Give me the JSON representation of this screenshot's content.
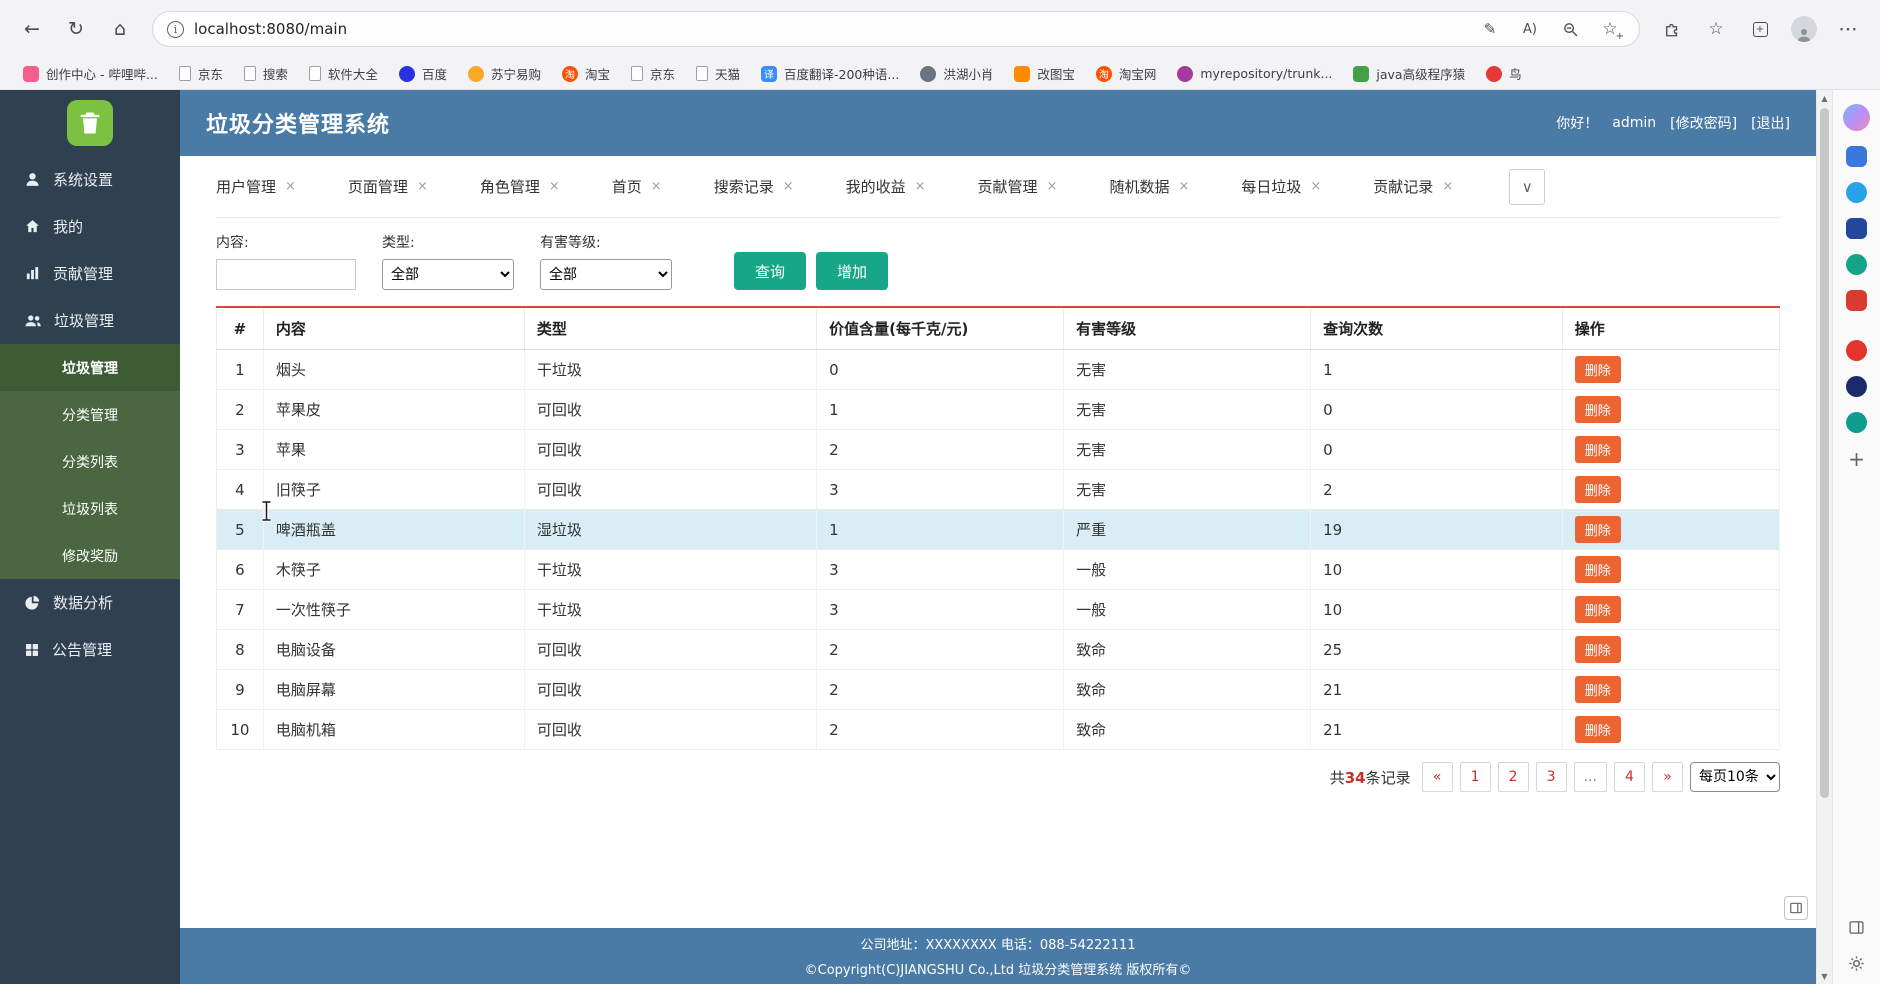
{
  "icons": {
    "back": "←",
    "refresh": "↻",
    "home": "⌂",
    "info": "i",
    "pen": "✎",
    "read_aloud": "A)",
    "star": "☆",
    "plus": "+",
    "ellipsis": "⋯",
    "chevron_down": "∨",
    "close": "×",
    "scroll_up": "▲",
    "scroll_down": "▼",
    "taobao_glyph": "淘",
    "fanyi_glyph": "译"
  },
  "browser": {
    "url": "localhost:8080/main",
    "bookmarks": [
      {
        "label": "创作中心 - 哔哩哔..."
      },
      {
        "label": "京东"
      },
      {
        "label": "搜索"
      },
      {
        "label": "软件大全"
      },
      {
        "label": "百度"
      },
      {
        "label": "苏宁易购"
      },
      {
        "label": "淘宝"
      },
      {
        "label": "京东"
      },
      {
        "label": "天猫"
      },
      {
        "label": "百度翻译-200种语..."
      },
      {
        "label": "洪湖小肖"
      },
      {
        "label": "改图宝"
      },
      {
        "label": "淘宝网"
      },
      {
        "label": "myrepository/trunk..."
      },
      {
        "label": "java高级程序猿"
      },
      {
        "label": "鸟"
      }
    ]
  },
  "app": {
    "title": "垃圾分类管理系统",
    "user": {
      "greeting": "你好！",
      "name": "admin",
      "change_password": "[修改密码]",
      "logout": "[退出]"
    },
    "sidebar": {
      "items": [
        {
          "label": "系统设置"
        },
        {
          "label": "我的"
        },
        {
          "label": "贡献管理"
        },
        {
          "label": "垃圾管理"
        },
        {
          "label": "数据分析"
        },
        {
          "label": "公告管理"
        }
      ],
      "submenu": [
        {
          "label": "垃圾管理"
        },
        {
          "label": "分类管理"
        },
        {
          "label": "分类列表"
        },
        {
          "label": "垃圾列表"
        },
        {
          "label": "修改奖励"
        }
      ]
    },
    "tabs": [
      {
        "label": "用户管理"
      },
      {
        "label": "页面管理"
      },
      {
        "label": "角色管理"
      },
      {
        "label": "首页"
      },
      {
        "label": "搜索记录"
      },
      {
        "label": "我的收益"
      },
      {
        "label": "贡献管理"
      },
      {
        "label": "随机数据"
      },
      {
        "label": "每日垃圾"
      },
      {
        "label": "贡献记录"
      }
    ],
    "filters": {
      "content_label": "内容:",
      "type_label": "类型:",
      "type_value": "全部",
      "level_label": "有害等级:",
      "level_value": "全部",
      "search_label": "查询",
      "add_label": "增加"
    },
    "table": {
      "headers": [
        "#",
        "内容",
        "类型",
        "价值含量(每千克/元)",
        "有害等级",
        "查询次数",
        "操作"
      ],
      "delete_label": "删除",
      "rows": [
        {
          "num": "1",
          "content": "烟头",
          "type": "干垃圾",
          "value": "0",
          "level": "无害",
          "count": "1"
        },
        {
          "num": "2",
          "content": "苹果皮",
          "type": "可回收",
          "value": "1",
          "level": "无害",
          "count": "0"
        },
        {
          "num": "3",
          "content": "苹果",
          "type": "可回收",
          "value": "2",
          "level": "无害",
          "count": "0"
        },
        {
          "num": "4",
          "content": "旧筷子",
          "type": "可回收",
          "value": "3",
          "level": "无害",
          "count": "2"
        },
        {
          "num": "5",
          "content": "啤酒瓶盖",
          "type": "湿垃圾",
          "value": "1",
          "level": "严重",
          "count": "19"
        },
        {
          "num": "6",
          "content": "木筷子",
          "type": "干垃圾",
          "value": "3",
          "level": "一般",
          "count": "10"
        },
        {
          "num": "7",
          "content": "一次性筷子",
          "type": "干垃圾",
          "value": "3",
          "level": "一般",
          "count": "10"
        },
        {
          "num": "8",
          "content": "电脑设备",
          "type": "可回收",
          "value": "2",
          "level": "致命",
          "count": "25"
        },
        {
          "num": "9",
          "content": "电脑屏幕",
          "type": "可回收",
          "value": "2",
          "level": "致命",
          "count": "21"
        },
        {
          "num": "10",
          "content": "电脑机箱",
          "type": "可回收",
          "value": "2",
          "level": "致命",
          "count": "21"
        }
      ]
    },
    "pagination": {
      "total_prefix": "共",
      "total_count": "34",
      "total_suffix": "条记录",
      "buttons": [
        "«",
        "1",
        "2",
        "3",
        "...",
        "4",
        "»"
      ],
      "page_size_option": "每页10条"
    },
    "footer": {
      "line1": "公司地址：XXXXXXXX 电话：088-54222111",
      "line2": "©Copyright(C)JIANGSHU Co.,Ltd 垃圾分类管理系统 版权所有©"
    }
  }
}
